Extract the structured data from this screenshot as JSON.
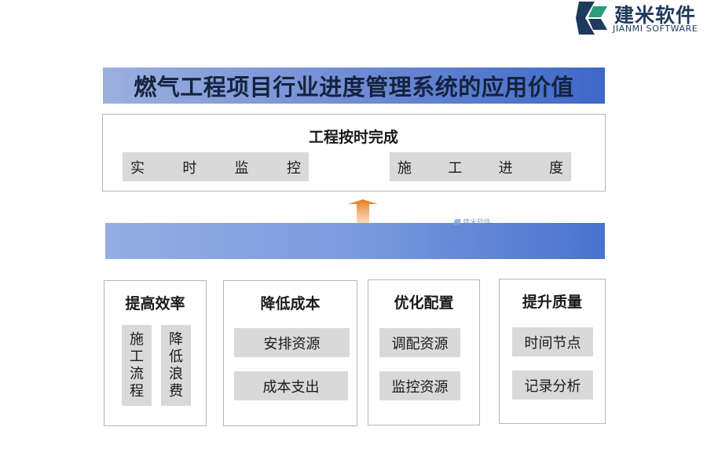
{
  "logo": {
    "name_cn": "建米软件",
    "name_en": "JIANMI SOFTWARE"
  },
  "title": "燃气工程项目行业进度管理系统的应用价值",
  "top": {
    "heading": "工程按时完成",
    "left_chip": [
      "实",
      "时",
      "监",
      "控"
    ],
    "right_chip": [
      "施",
      "工",
      "进",
      "度"
    ]
  },
  "watermark": "建米软件",
  "columns": [
    {
      "title": "提高效率",
      "vertical_items": [
        [
          "施",
          "工",
          "流",
          "程"
        ],
        [
          "降",
          "低",
          "浪",
          "费"
        ]
      ]
    },
    {
      "title": "降低成本",
      "items": [
        "安排资源",
        "成本支出"
      ]
    },
    {
      "title": "优化配置",
      "items": [
        "调配资源",
        "监控资源"
      ]
    },
    {
      "title": "提升质量",
      "items": [
        "时间节点",
        "记录分析"
      ]
    }
  ],
  "colors": {
    "banner_start": "#9bb0de",
    "banner_end": "#3e68c8",
    "chip": "#d9d9d9",
    "arrow": "#f08a2a",
    "logo": "#1e3a5c"
  }
}
